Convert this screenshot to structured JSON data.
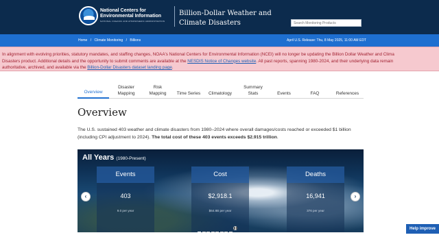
{
  "header": {
    "org_line1": "National Centers for",
    "org_line2": "Environmental Information",
    "org_line3": "NATIONAL OCEANIC AND ATMOSPHERIC ADMINISTRATION",
    "title": "Billion-Dollar Weather and Climate Disasters",
    "search_placeholder": "Search Monitoring Products"
  },
  "breadcrumb": {
    "items": [
      "Home",
      "/",
      "Climate Monitoring",
      "/",
      "Billions"
    ]
  },
  "release": "April U.S. Release: Thu, 8 May 2025, 11:00 AM EDT",
  "notice": {
    "line1": "In alignment with evolving priorities, statutory mandates, and staffing changes, NOAA's National Centers for Environmental Information (NCEI) will no longer be updating the Billion Dollar Weather and Clima",
    "line2_pre": "Disasters product. Additional details and the opportunity to submit comments are available at the ",
    "line2_link": "NESDIS Notice of Changes website",
    "line2_post": ". All past reports, spanning 1980-2024, and their underlying data remain",
    "line3_pre": "authoritative, archived, and available via the ",
    "line3_link": "Billion-Dollar Disasters dataset landing page",
    "line3_post": "."
  },
  "tabs": [
    {
      "l1": "",
      "l2": "Overview"
    },
    {
      "l1": "Disaster",
      "l2": "Mapping"
    },
    {
      "l1": "Risk",
      "l2": "Mapping"
    },
    {
      "l1": "",
      "l2": "Time Series"
    },
    {
      "l1": "",
      "l2": "Climatology"
    },
    {
      "l1": "Summary",
      "l2": "Stats"
    },
    {
      "l1": "",
      "l2": "Events"
    },
    {
      "l1": "",
      "l2": "FAQ"
    },
    {
      "l1": "",
      "l2": "References"
    }
  ],
  "overview": {
    "heading": "Overview",
    "intro_pre": "The U.S. sustained 403 weather and climate disasters from 1980–2024 where overall damages/costs reached or exceeded $1 billion (including CPI adjustment to 2024). ",
    "intro_bold": "The total cost of these 403 events exceeds $2.915 trillion",
    "intro_post": "."
  },
  "hero": {
    "title": "All Years",
    "title_sub": "(1980-Present)",
    "cards": [
      {
        "label": "Events",
        "value": "403",
        "sub": "9.0 per year"
      },
      {
        "label": "Cost",
        "value": "$2,918.1",
        "sub": "$64.8B per year"
      },
      {
        "label": "Deaths",
        "value": "16,941",
        "sub": "376 per year"
      }
    ],
    "prev_icon": "chevron-left",
    "next_icon": "chevron-right",
    "slide_count": 9,
    "active_slide": 1,
    "pause_icon": "pause"
  },
  "help_button": "Help improve"
}
